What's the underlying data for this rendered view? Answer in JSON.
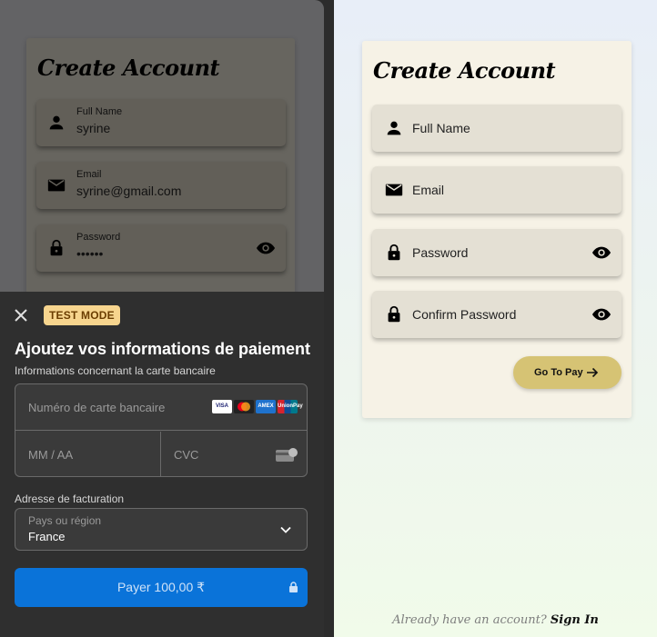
{
  "left_screen": {
    "title": "Create Account",
    "fields": [
      {
        "label": "Full Name",
        "value": "syrine",
        "icon": "person-icon"
      },
      {
        "label": "Email",
        "value": "syrine@gmail.com",
        "icon": "mail-icon"
      },
      {
        "label": "Password",
        "value": "••••••",
        "icon": "lock-icon"
      }
    ]
  },
  "payment_sheet": {
    "badge": "TEST MODE",
    "title": "Ajoutez vos informations de paiement",
    "subtitle": "Informations concernant la carte bancaire",
    "card_number_placeholder": "Numéro de carte bancaire",
    "expiry_placeholder": "MM / AA",
    "cvc_placeholder": "CVC",
    "brands": [
      "VISA",
      "MC",
      "AMEX",
      "UnionPay"
    ],
    "billing_label": "Adresse de facturation",
    "country_placeholder": "Pays ou région",
    "country_value": "France",
    "pay_button": "Payer 100,00 ₹",
    "colors": {
      "pay_button": "#0a73d9",
      "badge_bg": "#f7d58e"
    }
  },
  "right_screen": {
    "title": "Create Account",
    "fields": [
      {
        "label": "Full Name",
        "icon": "person-icon"
      },
      {
        "label": "Email",
        "icon": "mail-icon"
      },
      {
        "label": "Password",
        "icon": "lock-icon"
      },
      {
        "label": "Confirm Password",
        "icon": "lock-icon"
      }
    ],
    "go_to_pay": "Go To Pay",
    "already": "Already have an account?",
    "sign_in": "Sign In",
    "colors": {
      "go_to_pay": "#d6c374",
      "card": "#f6f2e6"
    }
  }
}
